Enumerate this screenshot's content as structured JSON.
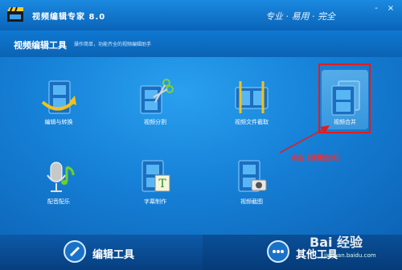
{
  "window": {
    "title": "视频编辑专家 8.0",
    "slogan": "专业 · 易用 · 完全",
    "minimize": "-",
    "close": "×"
  },
  "header": {
    "title": "视频编辑工具",
    "subtitle": "操作简单，功能齐全的视频编辑助手"
  },
  "tools": [
    {
      "label": "编辑与转换"
    },
    {
      "label": "视频分割"
    },
    {
      "label": "视频文件截取"
    },
    {
      "label": "视频合并"
    },
    {
      "label": "配音配乐"
    },
    {
      "label": "字幕制作"
    },
    {
      "label": "视频截图"
    }
  ],
  "annotation": "点击【视频合并】",
  "bottom": {
    "edit_tab": "编辑工具",
    "other_tab": "其他工具"
  },
  "watermark": {
    "brand": "Bai 经验",
    "url": "jingyan.baidu.com"
  },
  "colors": {
    "accent": "#0b63b4",
    "highlight": "#e41c1c"
  }
}
